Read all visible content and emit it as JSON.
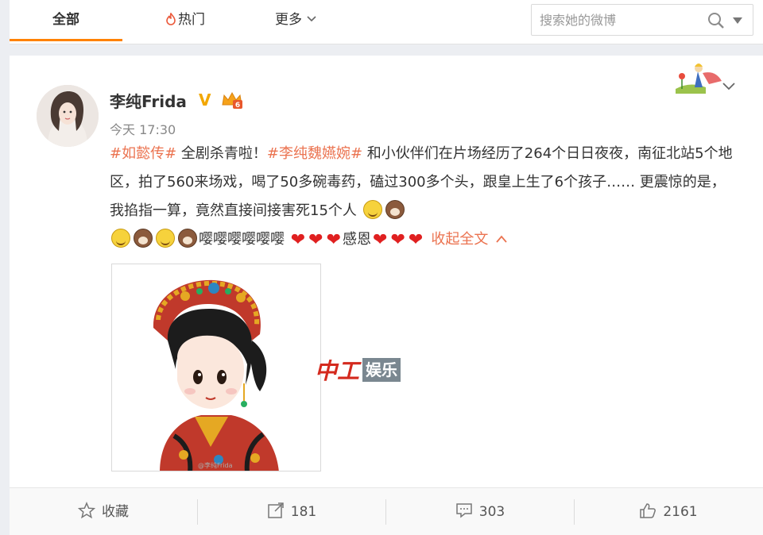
{
  "tabs": [
    {
      "label": "全部"
    },
    {
      "label": "热门"
    },
    {
      "label": "更多"
    }
  ],
  "search": {
    "placeholder": "搜索她的微博"
  },
  "post": {
    "username": "李纯Frida",
    "verified_mark": "V",
    "time": "今天 17:30",
    "topic1": "#如懿传#",
    "seg1": " 全剧杀青啦！",
    "topic2": "#李纯魏嬿婉#",
    "seg2": " 和小伙伴们在片场经历了264个日日夜夜，南征北站5个地区，拍了560来场戏，喝了50多碗毒药，磕过300多个头，跟皇上生了6个孩子…… 更震惊的是，我掐指一算，竟然直接间接害死15个人 ",
    "seg3": "嘤嘤嘤嘤嘤嘤 ",
    "seg4": "感恩",
    "collapse_label": "收起全文",
    "image_caption": "@李纯Frida"
  },
  "watermark": {
    "red": "中工",
    "box": "娱乐"
  },
  "actions": {
    "favorite": "收藏",
    "forward": "181",
    "comment": "303",
    "like": "2161"
  },
  "colors": {
    "accent": "#ff8200",
    "topic": "#eb7350",
    "heart": "#e02020"
  }
}
